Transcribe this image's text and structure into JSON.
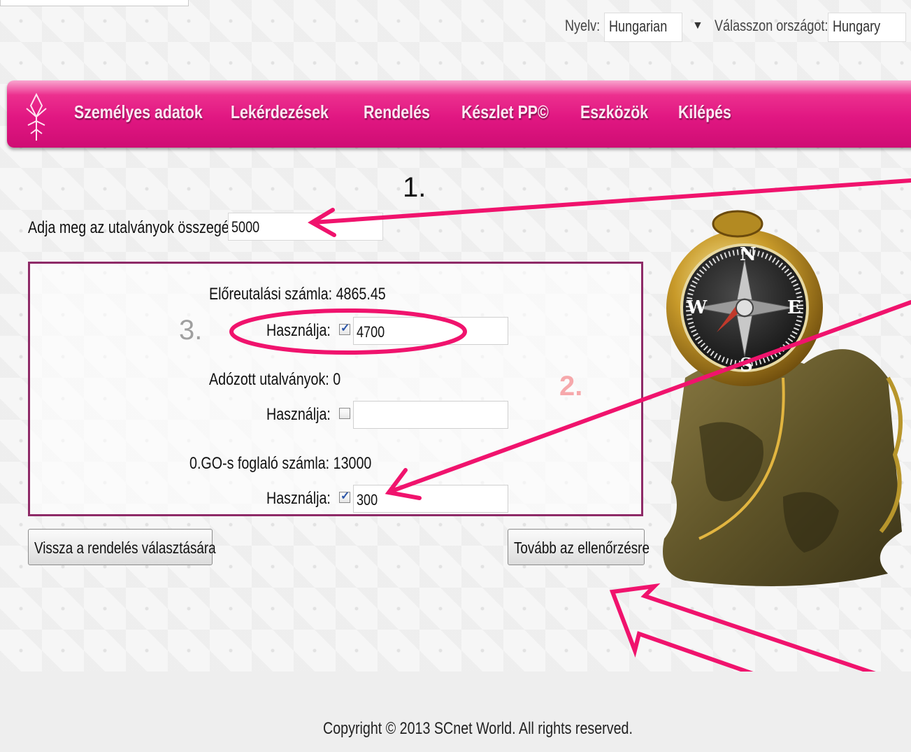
{
  "header": {
    "language_label": "Nyelv:",
    "language_value": "Hungarian",
    "country_label": "Válasszon országot:",
    "country_value": "Hungary"
  },
  "nav": {
    "items": [
      "Személyes adatok",
      "Lekérdezések",
      "Rendelés",
      "Készlet PP©",
      "Eszközök",
      "Kilépés"
    ]
  },
  "annotations": {
    "step1": "1.",
    "step2": "2.",
    "step3": "3."
  },
  "form": {
    "amount_label": "Adja meg az utalványok összegét:",
    "amount_value": "5000",
    "sections": [
      {
        "label": "Előreutalási számla: 4865.45",
        "use_label": "Használja:",
        "checked": true,
        "value": "4700"
      },
      {
        "label": "Adózott utalványok: 0",
        "use_label": "Használja:",
        "checked": false,
        "value": ""
      },
      {
        "label": "0.GO-s foglaló számla: 13000",
        "use_label": "Használja:",
        "checked": true,
        "value": "300"
      }
    ],
    "back_button": "Vissza a rendelés választására",
    "next_button": "Tovább az ellenőrzésre"
  },
  "footer": {
    "copyright": "Copyright © 2013 SCnet World. All rights reserved."
  },
  "colors": {
    "nav_pink": "#e11782",
    "panel_border": "#8e2a67",
    "arrow": "#f0136d",
    "annotation_red": "#e8262e"
  }
}
